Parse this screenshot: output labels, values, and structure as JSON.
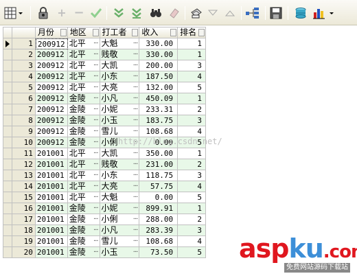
{
  "toolbar": {
    "icons": [
      "grid-view-icon",
      "lock-icon",
      "add-icon",
      "delete-icon",
      "post-icon",
      "filter-icon",
      "filter-clear-icon",
      "find-icon",
      "eraser-icon",
      "print-icon",
      "sort-desc-icon",
      "sort-asc-icon",
      "tree-icon",
      "save-icon",
      "db-icon",
      "chart-icon"
    ]
  },
  "grid": {
    "columns": [
      "月份",
      "地区",
      "打工者",
      "收入",
      "排名"
    ],
    "ellipsis": "···",
    "rows": [
      {
        "n": "1",
        "month": "200912",
        "area": "北平",
        "worker": "大魁",
        "income": "330.00",
        "rank": "1"
      },
      {
        "n": "2",
        "month": "200912",
        "area": "北平",
        "worker": "贱敬",
        "income": "330.00",
        "rank": "1"
      },
      {
        "n": "3",
        "month": "200912",
        "area": "北平",
        "worker": "大凯",
        "income": "200.00",
        "rank": "3"
      },
      {
        "n": "4",
        "month": "200912",
        "area": "北平",
        "worker": "小东",
        "income": "187.50",
        "rank": "4"
      },
      {
        "n": "5",
        "month": "200912",
        "area": "北平",
        "worker": "大亮",
        "income": "132.00",
        "rank": "5"
      },
      {
        "n": "6",
        "month": "200912",
        "area": "金陵",
        "worker": "小凡",
        "income": "450.09",
        "rank": "1"
      },
      {
        "n": "7",
        "month": "200912",
        "area": "金陵",
        "worker": "小妮",
        "income": "233.31",
        "rank": "2"
      },
      {
        "n": "8",
        "month": "200912",
        "area": "金陵",
        "worker": "小玉",
        "income": "183.75",
        "rank": "3"
      },
      {
        "n": "9",
        "month": "200912",
        "area": "金陵",
        "worker": "雪儿",
        "income": "108.68",
        "rank": "4"
      },
      {
        "n": "10",
        "month": "200912",
        "area": "金陵",
        "worker": "小俐",
        "income": "0.00",
        "rank": "5"
      },
      {
        "n": "11",
        "month": "201001",
        "area": "北平",
        "worker": "大凯",
        "income": "350.00",
        "rank": "1"
      },
      {
        "n": "12",
        "month": "201001",
        "area": "北平",
        "worker": "贱敬",
        "income": "231.00",
        "rank": "2"
      },
      {
        "n": "13",
        "month": "201001",
        "area": "北平",
        "worker": "小东",
        "income": "118.75",
        "rank": "3"
      },
      {
        "n": "14",
        "month": "201001",
        "area": "北平",
        "worker": "大亮",
        "income": "57.75",
        "rank": "4"
      },
      {
        "n": "15",
        "month": "201001",
        "area": "北平",
        "worker": "大魁",
        "income": "0.00",
        "rank": "5"
      },
      {
        "n": "16",
        "month": "201001",
        "area": "金陵",
        "worker": "小妮",
        "income": "899.91",
        "rank": "1"
      },
      {
        "n": "17",
        "month": "201001",
        "area": "金陵",
        "worker": "小俐",
        "income": "288.00",
        "rank": "2"
      },
      {
        "n": "18",
        "month": "201001",
        "area": "金陵",
        "worker": "小凡",
        "income": "283.39",
        "rank": "3"
      },
      {
        "n": "19",
        "month": "201001",
        "area": "金陵",
        "worker": "雪儿",
        "income": "108.68",
        "rank": "4"
      },
      {
        "n": "20",
        "month": "201001",
        "area": "金陵",
        "worker": "小玉",
        "income": "73.50",
        "rank": "5"
      }
    ]
  },
  "watermark": "http://blog.csdn.net/",
  "logo": {
    "a": "asp",
    "b": "ku",
    "c": ".com",
    "sub": "免费网站源码下载站"
  },
  "colors": {
    "alt_row": "#e8f8e8",
    "logo_red": "#e0171f",
    "logo_blue": "#3d8fd8"
  }
}
